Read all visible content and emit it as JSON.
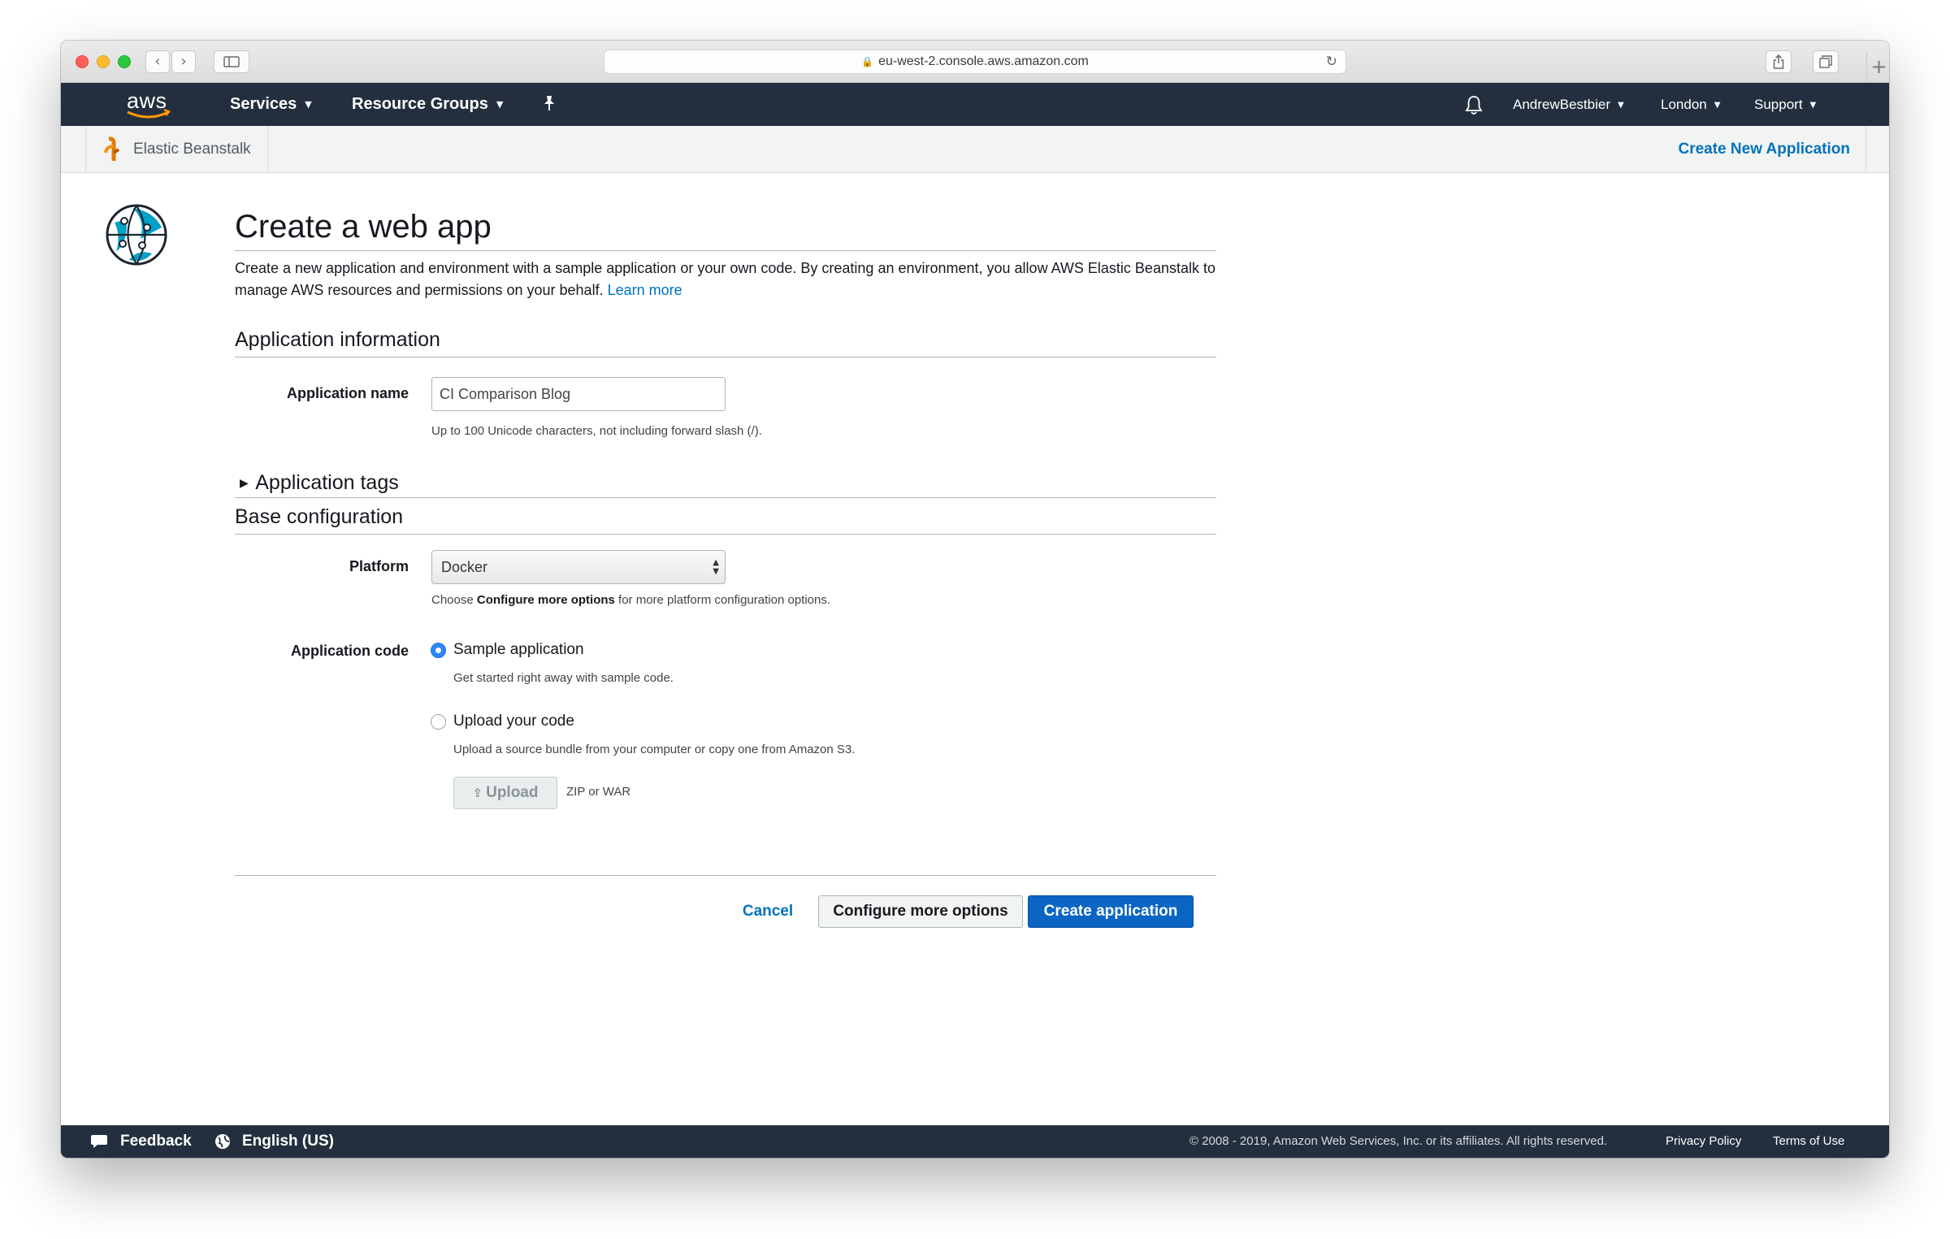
{
  "browser": {
    "url": "eu-west-2.console.aws.amazon.com"
  },
  "aws_nav": {
    "logo_text": "aws",
    "services": "Services",
    "resource_groups": "Resource Groups",
    "account": "AndrewBestbier",
    "region": "London",
    "support": "Support"
  },
  "service_bar": {
    "service_name": "Elastic Beanstalk",
    "create_new": "Create New Application"
  },
  "page": {
    "title": "Create a web app",
    "description": "Create a new application and environment with a sample application or your own code. By creating an environment, you allow AWS Elastic Beanstalk to manage AWS resources and permissions on your behalf.",
    "learn_more": "Learn more"
  },
  "app_info": {
    "section_title": "Application information",
    "name_label": "Application name",
    "name_value": "CI Comparison Blog",
    "name_hint": "Up to 100 Unicode characters, not including forward slash (/)."
  },
  "app_tags": {
    "section_title": "Application tags"
  },
  "base_config": {
    "section_title": "Base configuration",
    "platform_label": "Platform",
    "platform_value": "Docker",
    "platform_hint_prefix": "Choose",
    "platform_hint_bold": "Configure more options",
    "platform_hint_suffix": "for more platform configuration options.",
    "code_label": "Application code",
    "sample_label": "Sample application",
    "sample_hint": "Get started right away with sample code.",
    "sample_selected": true,
    "upload_label": "Upload your code",
    "upload_hint": "Upload a source bundle from your computer or copy one from Amazon S3.",
    "upload_button": "Upload",
    "upload_formats": "ZIP or WAR"
  },
  "actions": {
    "cancel": "Cancel",
    "configure": "Configure more options",
    "create": "Create application"
  },
  "footer": {
    "feedback": "Feedback",
    "language": "English (US)",
    "copyright": "© 2008 - 2019, Amazon Web Services, Inc. or its affiliates. All rights reserved.",
    "privacy": "Privacy Policy",
    "terms": "Terms of Use"
  },
  "colors": {
    "nav_bg": "#232f3e",
    "link": "#0073bb",
    "primary_button": "#0a66c2",
    "aws_orange": "#ff9900"
  },
  "icons": [
    "back-icon",
    "forward-icon",
    "sidebar-icon",
    "lock-icon",
    "reload-icon",
    "share-icon",
    "tabs-icon",
    "new-tab-icon",
    "pin-icon",
    "bell-icon",
    "elastic-beanstalk-icon",
    "globe-icon",
    "expand-triangle-icon",
    "upload-icon",
    "feedback-icon",
    "language-globe-icon"
  ]
}
